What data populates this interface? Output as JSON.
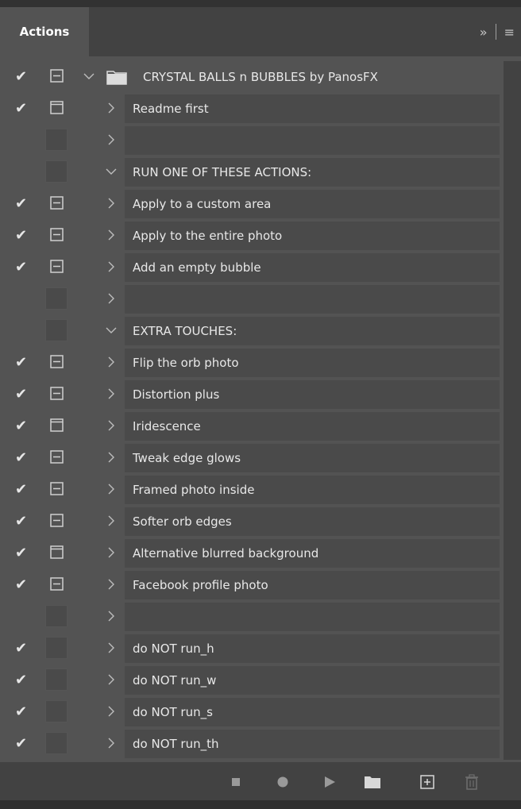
{
  "panel": {
    "tab_label": "Actions",
    "more_icon": "double-chevron-right",
    "menu_icon": "hamburger-menu"
  },
  "set": {
    "label": "CRYSTAL BALLS n BUBBLES by PanosFX",
    "checked": true,
    "dialog": true,
    "expanded": true
  },
  "actions": [
    {
      "label": "Readme first",
      "checked": true,
      "dialog": "outline",
      "expanded": false
    },
    {
      "label": "",
      "checked": false,
      "dialog": "empty",
      "expanded": false
    },
    {
      "label": "RUN ONE OF THESE ACTIONS:",
      "checked": false,
      "dialog": "empty",
      "expanded": true
    },
    {
      "label": "Apply to a custom area",
      "checked": true,
      "dialog": "dialog",
      "expanded": false
    },
    {
      "label": "Apply to the entire photo",
      "checked": true,
      "dialog": "dialog",
      "expanded": false
    },
    {
      "label": "Add an empty bubble",
      "checked": true,
      "dialog": "dialog",
      "expanded": false
    },
    {
      "label": "",
      "checked": false,
      "dialog": "empty",
      "expanded": false
    },
    {
      "label": "EXTRA TOUCHES:",
      "checked": false,
      "dialog": "empty",
      "expanded": true
    },
    {
      "label": "Flip the orb photo",
      "checked": true,
      "dialog": "dialog",
      "expanded": false
    },
    {
      "label": "Distortion plus",
      "checked": true,
      "dialog": "dialog",
      "expanded": false
    },
    {
      "label": "Iridescence",
      "checked": true,
      "dialog": "outline",
      "expanded": false
    },
    {
      "label": "Tweak edge glows",
      "checked": true,
      "dialog": "dialog",
      "expanded": false
    },
    {
      "label": "Framed photo inside",
      "checked": true,
      "dialog": "dialog",
      "expanded": false
    },
    {
      "label": "Softer orb edges",
      "checked": true,
      "dialog": "dialog",
      "expanded": false
    },
    {
      "label": "Alternative blurred background",
      "checked": true,
      "dialog": "outline",
      "expanded": false
    },
    {
      "label": "Facebook profile photo",
      "checked": true,
      "dialog": "dialog",
      "expanded": false
    },
    {
      "label": "",
      "checked": false,
      "dialog": "empty",
      "expanded": false
    },
    {
      "label": "do NOT run_h",
      "checked": true,
      "dialog": "empty",
      "expanded": false
    },
    {
      "label": "do NOT run_w",
      "checked": true,
      "dialog": "empty",
      "expanded": false
    },
    {
      "label": "do NOT run_s",
      "checked": true,
      "dialog": "empty",
      "expanded": false
    },
    {
      "label": "do NOT run_th",
      "checked": true,
      "dialog": "empty",
      "expanded": false
    }
  ],
  "toolbar": {
    "buttons": [
      "stop-icon",
      "record-icon",
      "play-icon",
      "new-set-folder-icon",
      "new-action-icon",
      "delete-icon"
    ]
  },
  "colors": {
    "panel_bg": "#535353",
    "row_bg": "#4a4a4a",
    "tabbar_bg": "#424242",
    "text": "#e8e8e8"
  }
}
